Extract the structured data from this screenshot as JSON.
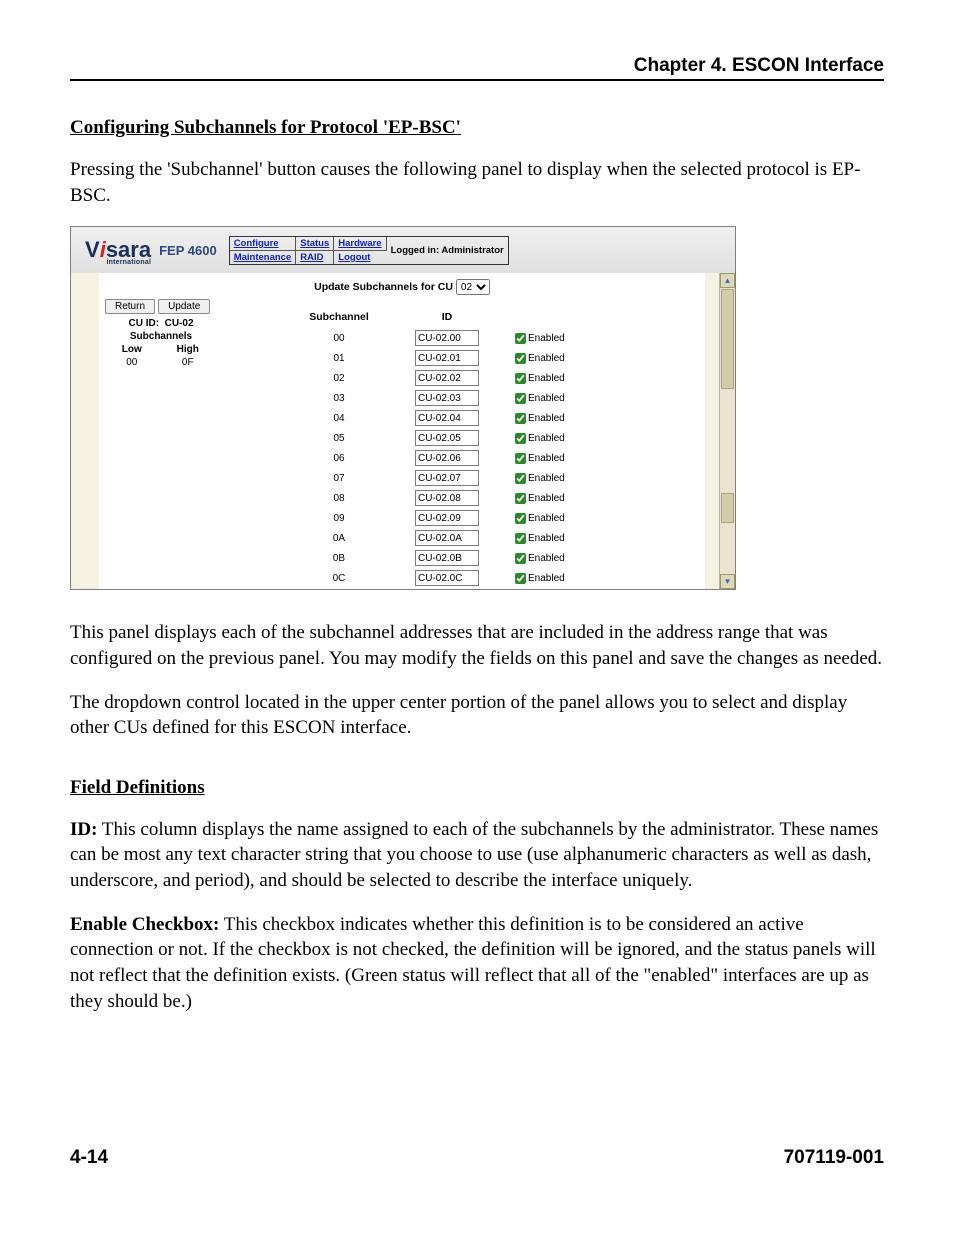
{
  "chapter": "Chapter 4. ESCON Interface",
  "section_title": "Configuring Subchannels for Protocol 'EP-BSC'",
  "para_intro": "Pressing the 'Subchannel' button causes the following panel to display when the selected protocol is EP-BSC.",
  "para_after_1": "This panel displays each of the subchannel addresses that are included in the address range that was configured on the previous panel. You may modify the fields on this panel and save the changes as needed.",
  "para_after_2": "The dropdown control located in the upper center portion of the panel allows you to select and display other CUs defined for this ESCON interface.",
  "field_def_title": "Field Definitions",
  "fd_id_label": "ID:",
  "fd_id_text": "  This column displays the name assigned to each of the subchannels by the administrator. These names can be most any text character string that you choose to use (use alphanumeric characters as well as dash, underscore, and period), and should be selected to describe the interface uniquely.",
  "fd_en_label": "Enable Checkbox:",
  "fd_en_text": "  This checkbox indicates whether this definition is to be considered an active connection or not. If the checkbox is not checked, the definition will be ignored, and the status panels will not reflect that the definition exists. (Green status will reflect that all of the \"enabled\" interfaces are up as they should be.)",
  "footer_left": "4-14",
  "footer_right": "707119-001",
  "ss": {
    "logo_main": "V",
    "logo_i": "i",
    "logo_rest": "sara",
    "logo_sub": "international",
    "product": "FEP 4600",
    "nav": {
      "configure": "Configure",
      "status": "Status",
      "hardware": "Hardware",
      "maintenance": "Maintenance",
      "raid": "RAID",
      "logout": "Logout",
      "logged": "Logged in: Administrator"
    },
    "upd_text": "Update Subchannels for CU",
    "cu_sel": "02",
    "btn_return": "Return",
    "btn_update": "Update",
    "cu_id_label": "CU ID:",
    "cu_id_val": "CU-02",
    "subch_label": "Subchannels",
    "low": "Low",
    "high": "High",
    "low_v": "00",
    "high_v": "0F",
    "th_sub": "Subchannel",
    "th_id": "ID",
    "enabled": "Enabled",
    "rows": [
      {
        "sc": "00",
        "id": "CU-02.00"
      },
      {
        "sc": "01",
        "id": "CU-02.01"
      },
      {
        "sc": "02",
        "id": "CU-02.02"
      },
      {
        "sc": "03",
        "id": "CU-02.03"
      },
      {
        "sc": "04",
        "id": "CU-02.04"
      },
      {
        "sc": "05",
        "id": "CU-02.05"
      },
      {
        "sc": "06",
        "id": "CU-02.06"
      },
      {
        "sc": "07",
        "id": "CU-02.07"
      },
      {
        "sc": "08",
        "id": "CU-02.08"
      },
      {
        "sc": "09",
        "id": "CU-02.09"
      },
      {
        "sc": "0A",
        "id": "CU-02.0A"
      },
      {
        "sc": "0B",
        "id": "CU-02.0B"
      },
      {
        "sc": "0C",
        "id": "CU-02.0C"
      }
    ]
  }
}
